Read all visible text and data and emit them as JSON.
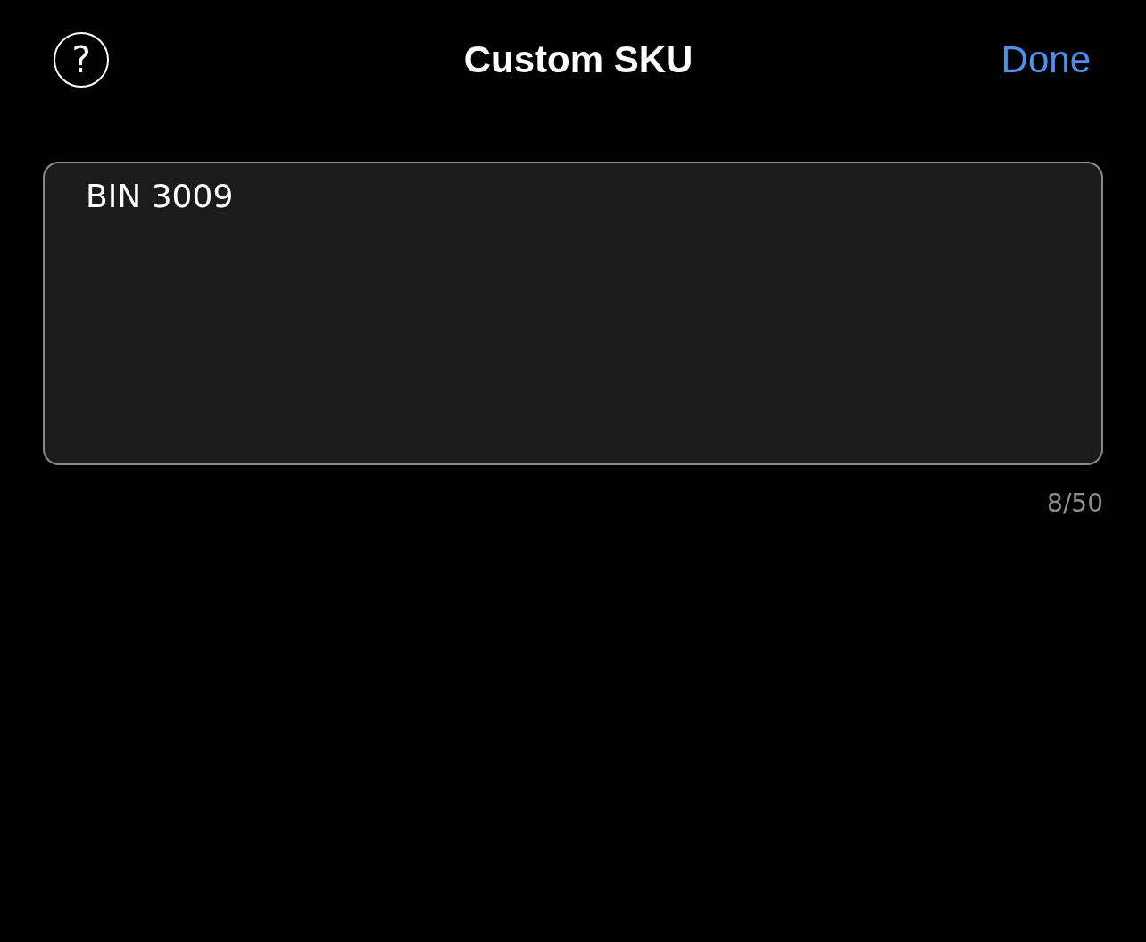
{
  "header": {
    "help_icon": "?",
    "title": "Custom SKU",
    "done_button": "Done"
  },
  "sku_field": {
    "value": "BIN 3009"
  },
  "character_count": "8/50"
}
